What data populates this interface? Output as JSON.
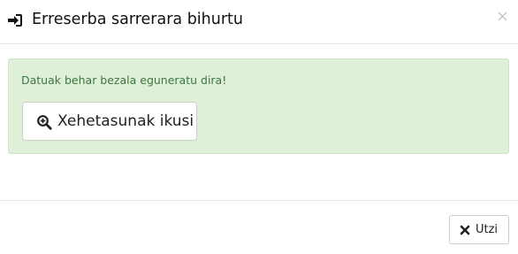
{
  "header": {
    "title": "Erreserba sarrerara bihurtu",
    "title_icon": "sign-in-icon",
    "close_symbol": "×"
  },
  "alert": {
    "message": "Datuak behar bezala eguneratu dira!",
    "details_button_label": "Xehetasunak ikusi",
    "details_button_icon": "zoom-in-icon"
  },
  "footer": {
    "close_button_label": "Utzi",
    "close_button_icon": "close-icon"
  },
  "colors": {
    "alert_background": "#dff0d8",
    "alert_text": "#3c763d"
  }
}
